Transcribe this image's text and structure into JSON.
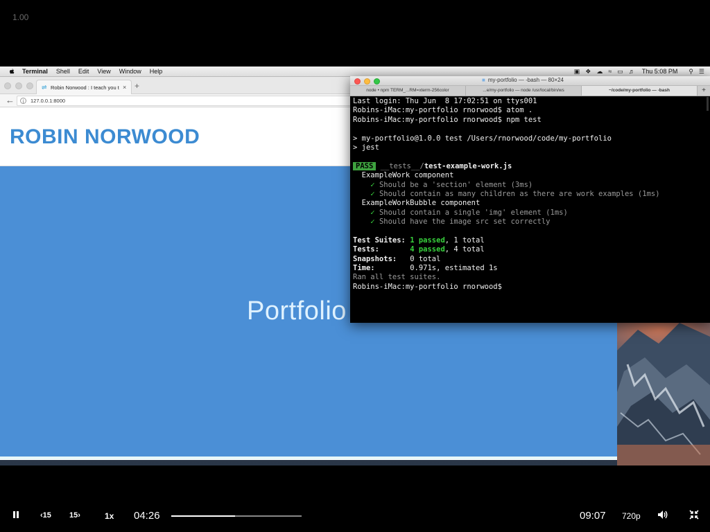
{
  "player": {
    "rate_label": "1.00",
    "current_time": "04:26",
    "duration": "09:07",
    "speed": "1x",
    "skip_back": "15",
    "skip_forward": "15",
    "quality": "720p",
    "progress": 0.487
  },
  "menubar": {
    "app": "Terminal",
    "items": [
      "Shell",
      "Edit",
      "View",
      "Window",
      "Help"
    ],
    "clock": "Thu 5:08 PM"
  },
  "browser": {
    "tab_title": "Robin Norwood : I teach you t",
    "url": "127.0.0.1:8000",
    "site_name": "ROBIN NORWOOD",
    "hero_title": "Portfolio"
  },
  "terminal": {
    "title": "my-portfolio — -bash — 80×24",
    "tabs": [
      "node • npm TERM_...RM=xterm-256color",
      "...e/my-portfolio — node /usr/local/bin/ws",
      "~/code/my-portfolio — -bash"
    ],
    "lines": {
      "l1": "Last login: Thu Jun  8 17:02:51 on ttys001",
      "l2": "Robins-iMac:my-portfolio rnorwood$ atom .",
      "l3": "Robins-iMac:my-portfolio rnorwood$ npm test",
      "l4": "> my-portfolio@1.0.0 test /Users/rnorwood/code/my-portfolio",
      "l5": "> jest",
      "pass": "PASS",
      "test_dir": "__tests__/",
      "test_file": "test-example-work.js",
      "suite1": "  ExampleWork component",
      "t1": "Should be a 'section' element (3ms)",
      "t2": "Should contain as many children as there are work examples (1ms)",
      "suite2": "  ExampleWorkBubble component",
      "t3": "Should contain a single 'img' element (1ms)",
      "t4": "Should have the image src set correctly",
      "suites_label": "Test Suites: ",
      "suites_pass": "1 passed",
      "suites_total": ", 1 total",
      "tests_label": "Tests:       ",
      "tests_pass": "4 passed",
      "tests_total": ", 4 total",
      "snap_label": "Snapshots:   ",
      "snap_val": "0 total",
      "time_label": "Time:        ",
      "time_val": "0.971s, estimated 1s",
      "ran": "Ran all test suites.",
      "prompt": "Robins-iMac:my-portfolio rnorwood$"
    }
  },
  "icons": {
    "apple": "apple-icon",
    "pause": "pause-icon",
    "volume": "volume-icon",
    "fullscreen": "exit-fullscreen-icon"
  }
}
